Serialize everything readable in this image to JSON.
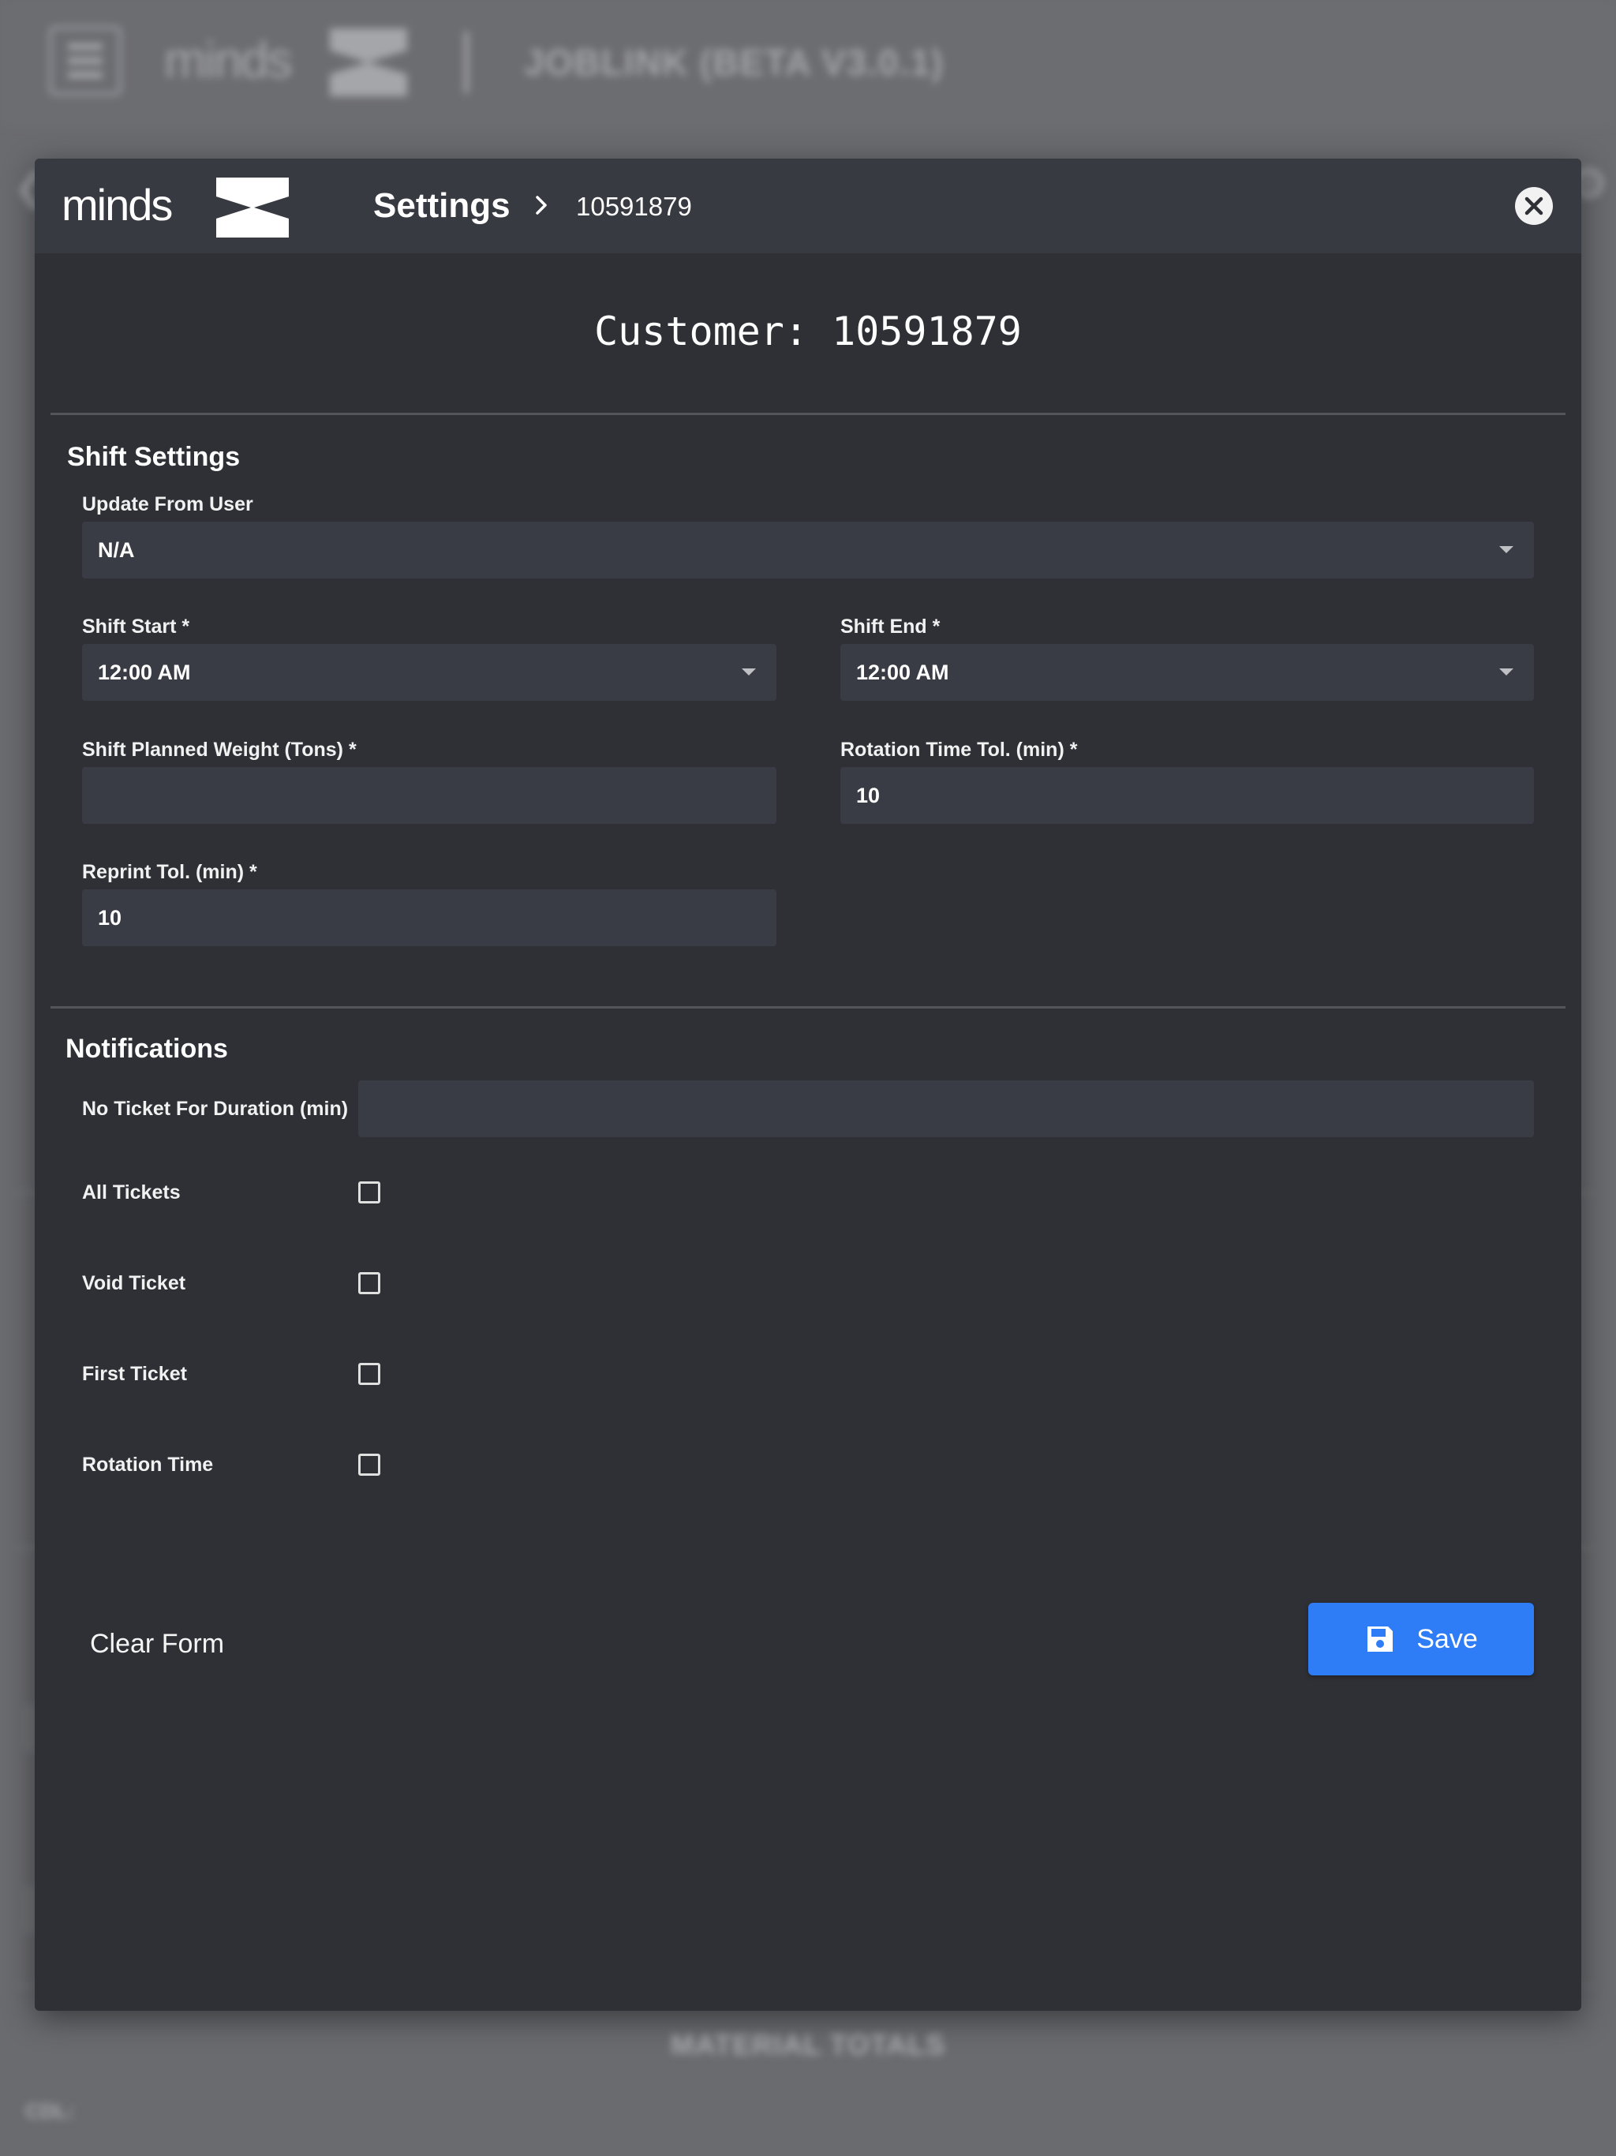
{
  "background": {
    "app_title": "JOBLINK (BETA V3.0.1)",
    "material_totals": "MATERIAL TOTALS",
    "cdl_label": "CDL:"
  },
  "modal": {
    "brand": "minds",
    "title": "Settings",
    "breadcrumb": "10591879",
    "customer_heading": "Customer: 10591879"
  },
  "shift_settings": {
    "title": "Shift Settings",
    "update_from_user": {
      "label": "Update From User",
      "value": "N/A"
    },
    "shift_start": {
      "label": "Shift Start *",
      "value": "12:00 AM"
    },
    "shift_end": {
      "label": "Shift End *",
      "value": "12:00 AM"
    },
    "shift_planned_weight": {
      "label": "Shift Planned Weight (Tons) *",
      "value": ""
    },
    "rotation_time_tol": {
      "label": "Rotation Time Tol. (min) *",
      "value": "10"
    },
    "reprint_tol": {
      "label": "Reprint Tol. (min) *",
      "value": "10"
    }
  },
  "notifications": {
    "title": "Notifications",
    "no_ticket_duration": {
      "label": "No Ticket For Duration (min)",
      "value": ""
    },
    "checkboxes": [
      {
        "label": "All Tickets",
        "checked": false
      },
      {
        "label": "Void Ticket",
        "checked": false
      },
      {
        "label": "First Ticket",
        "checked": false
      },
      {
        "label": "Rotation Time",
        "checked": false
      }
    ]
  },
  "actions": {
    "clear_label": "Clear Form",
    "save_label": "Save"
  },
  "colors": {
    "modal_bg": "#2f3036",
    "header_bg": "#383a42",
    "field_bg": "#3a3c45",
    "accent": "#2e7cf6"
  },
  "icons": [
    "menu-icon",
    "chevron-right-icon",
    "close-icon",
    "dropdown-caret-icon",
    "save-disk-icon",
    "back-chevron-icon",
    "gear-icon"
  ]
}
